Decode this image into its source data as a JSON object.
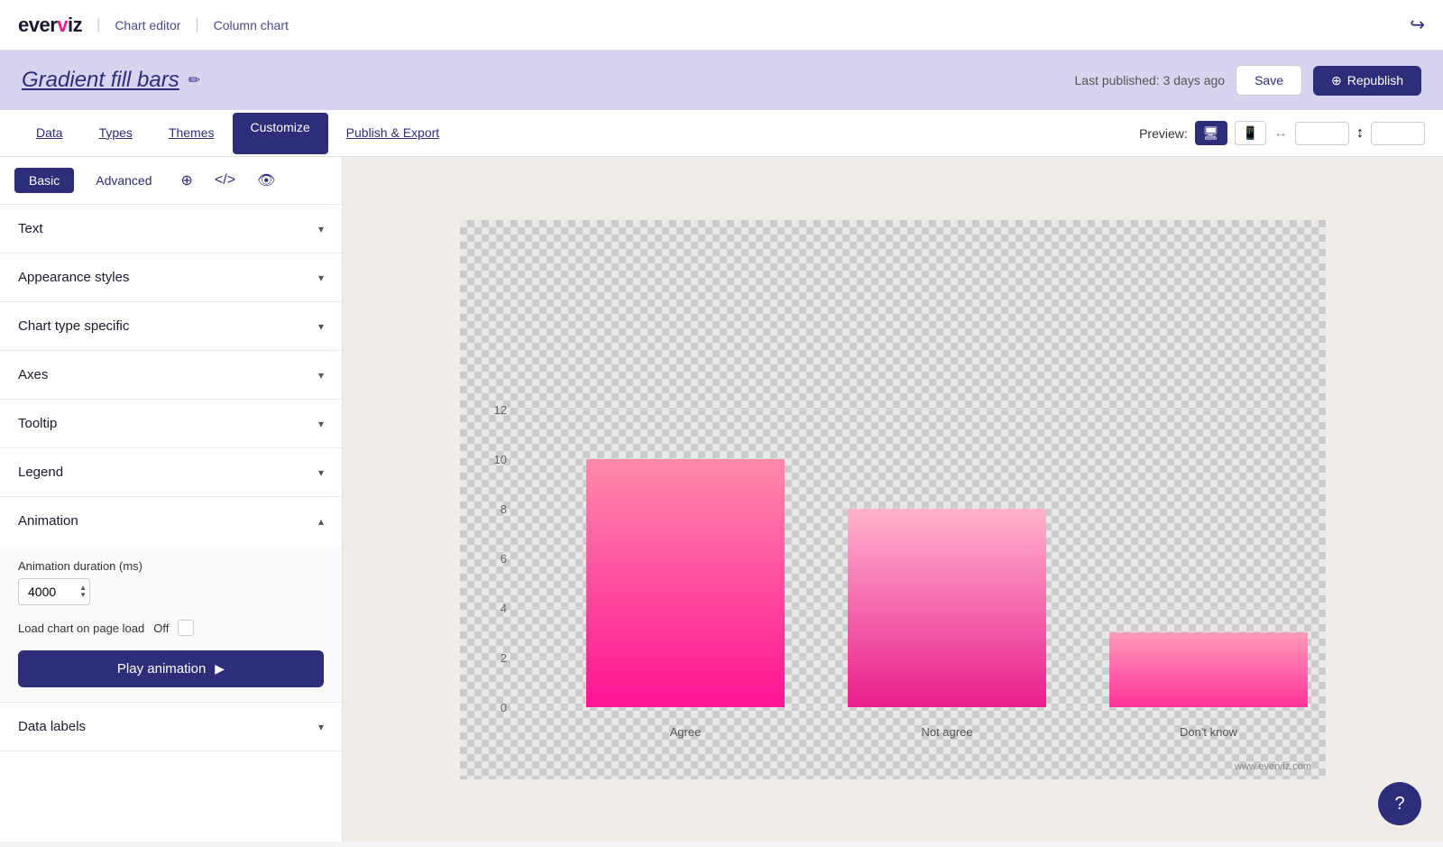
{
  "app": {
    "logo": "everviz",
    "logo_dot_char": "·",
    "breadcrumb_sep": "|",
    "breadcrumb_editor": "Chart editor",
    "breadcrumb_type": "Column chart"
  },
  "title_bar": {
    "chart_name": "Gradient fill bars",
    "edit_icon": "✏",
    "last_published_label": "Last published: 3 days ago",
    "save_label": "Save",
    "republish_label": "Republish",
    "republish_icon": "⊕"
  },
  "tabs": {
    "items": [
      {
        "id": "data",
        "label": "Data"
      },
      {
        "id": "types",
        "label": "Types"
      },
      {
        "id": "themes",
        "label": "Themes"
      },
      {
        "id": "customize",
        "label": "Customize",
        "active": true
      },
      {
        "id": "publish",
        "label": "Publish & Export"
      }
    ]
  },
  "preview": {
    "label": "Preview:",
    "desktop_icon": "🖥",
    "mobile_icon": "📱",
    "width_value": "",
    "height_icon": "↕",
    "height_value": ""
  },
  "sub_tabs": {
    "basic_label": "Basic",
    "advanced_label": "Advanced",
    "globe_icon": "⊕",
    "code_icon": "</>",
    "eye_icon": "👁"
  },
  "accordion": {
    "sections": [
      {
        "id": "text",
        "label": "Text",
        "expanded": false
      },
      {
        "id": "appearance",
        "label": "Appearance styles",
        "expanded": false
      },
      {
        "id": "chart_type",
        "label": "Chart type specific",
        "expanded": false
      },
      {
        "id": "axes",
        "label": "Axes",
        "expanded": false
      },
      {
        "id": "tooltip",
        "label": "Tooltip",
        "expanded": false
      },
      {
        "id": "legend",
        "label": "Legend",
        "expanded": false
      },
      {
        "id": "animation",
        "label": "Animation",
        "expanded": true
      },
      {
        "id": "data_labels",
        "label": "Data labels",
        "expanded": false
      }
    ]
  },
  "animation": {
    "duration_label": "Animation duration (ms)",
    "duration_value": "4000",
    "load_chart_label": "Load chart on page load",
    "load_chart_state": "Off",
    "play_label": "Play animation",
    "play_icon": "▶"
  },
  "chart": {
    "y_axis_labels": [
      "0",
      "2",
      "4",
      "6",
      "8",
      "10",
      "12"
    ],
    "bars": [
      {
        "label": "Agree",
        "value": 10,
        "color_top": "#ff6b9d",
        "color_bottom": "#ff1493"
      },
      {
        "label": "Not agree",
        "value": 8,
        "color_top": "#ff9dba",
        "color_bottom": "#e91e8c"
      },
      {
        "label": "Don't know",
        "value": 3,
        "color_top": "#ff8aaa",
        "color_bottom": "#ff1493"
      }
    ],
    "watermark": "www.everviz.com"
  },
  "help_btn": "?"
}
